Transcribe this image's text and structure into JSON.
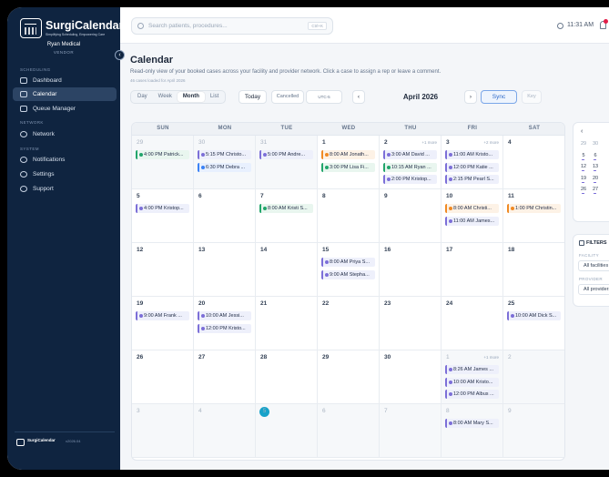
{
  "sidebar": {
    "brand": "SurgiCalendar",
    "tagline": "Simplifying Scheduling, Empowering Care",
    "user_name": "Ryan Medical",
    "user_role": "VENDOR",
    "sections": [
      {
        "label": "SCHEDULING"
      },
      {
        "label": "NETWORK"
      },
      {
        "label": "SYSTEM"
      }
    ],
    "items": [
      {
        "label": "Dashboard",
        "icon": "dashboard-icon"
      },
      {
        "label": "Calendar",
        "icon": "calendar-icon",
        "active": true
      },
      {
        "label": "Queue Manager",
        "icon": "queue-icon"
      },
      {
        "label": "Network",
        "icon": "network-icon"
      },
      {
        "label": "Notifications",
        "icon": "bell-icon"
      },
      {
        "label": "Settings",
        "icon": "gear-icon"
      },
      {
        "label": "Support",
        "icon": "help-icon"
      }
    ],
    "footer_brand": "SurgiCalendar",
    "footer_version": "v2026.04"
  },
  "topbar": {
    "search_placeholder": "Search patients, procedures...",
    "shortcut": "Ctrl+K",
    "time": "11:31 AM"
  },
  "page": {
    "title": "Calendar",
    "subtitle": "Read-only view of your booked cases across your facility and provider network. Click a case to assign a rep or leave a comment.",
    "loaded": "46 cases loaded for April 2026"
  },
  "toolbar": {
    "views": [
      "Day",
      "Week",
      "Month",
      "List"
    ],
    "selected_view": "Month",
    "today": "Today",
    "cancelled": "Cancelled",
    "timezone": "UTC-5",
    "prev": "‹",
    "month_label": "April 2026",
    "next": "›",
    "sync": "Sync",
    "key": "Key"
  },
  "calendar": {
    "weekdays": [
      "SUN",
      "MON",
      "TUE",
      "WED",
      "THU",
      "FRI",
      "SAT"
    ],
    "days": [
      {
        "n": "29",
        "out": true,
        "events": [
          {
            "t": "4:00 PM Patrick...",
            "c": "green"
          }
        ]
      },
      {
        "n": "30",
        "out": true,
        "events": [
          {
            "t": "5:15 PM Christo...",
            "c": "purple"
          },
          {
            "t": "6:30 PM Debra ...",
            "c": "blue"
          }
        ]
      },
      {
        "n": "31",
        "out": true,
        "events": [
          {
            "t": "5:00 PM Andre...",
            "c": "purple"
          }
        ]
      },
      {
        "n": "1",
        "events": [
          {
            "t": "8:00 AM Jonath...",
            "c": "orange"
          },
          {
            "t": "3:00 PM Lisa Fi...",
            "c": "green"
          }
        ]
      },
      {
        "n": "2",
        "more": "+1 more",
        "events": [
          {
            "t": "3:00 AM David ...",
            "c": "purple"
          },
          {
            "t": "10:15 AM Ryan ...",
            "c": "green"
          },
          {
            "t": "2:00 PM Kristop...",
            "c": "purple"
          }
        ]
      },
      {
        "n": "3",
        "more": "+2 more",
        "events": [
          {
            "t": "11:00 AM Kristo...",
            "c": "purple"
          },
          {
            "t": "12:00 PM Katie ...",
            "c": "purple"
          },
          {
            "t": "2:15 PM Pearl S...",
            "c": "purple"
          }
        ]
      },
      {
        "n": "4",
        "events": []
      },
      {
        "n": "5",
        "events": [
          {
            "t": "4:00 PM Kristop...",
            "c": "purple"
          }
        ]
      },
      {
        "n": "6",
        "events": []
      },
      {
        "n": "7",
        "events": [
          {
            "t": "8:00 AM Kristi S...",
            "c": "green"
          }
        ]
      },
      {
        "n": "8",
        "events": []
      },
      {
        "n": "9",
        "events": []
      },
      {
        "n": "10",
        "events": [
          {
            "t": "8:00 AM Christi...",
            "c": "orange"
          },
          {
            "t": "11:00 AM James...",
            "c": "purple"
          }
        ]
      },
      {
        "n": "11",
        "events": [
          {
            "t": "1:00 PM Christin...",
            "c": "orange"
          }
        ]
      },
      {
        "n": "12",
        "events": []
      },
      {
        "n": "13",
        "events": []
      },
      {
        "n": "14",
        "events": []
      },
      {
        "n": "15",
        "events": [
          {
            "t": "8:00 AM Priya S...",
            "c": "purple"
          },
          {
            "t": "9:00 AM Stepha...",
            "c": "purple"
          }
        ]
      },
      {
        "n": "16",
        "events": []
      },
      {
        "n": "17",
        "events": []
      },
      {
        "n": "18",
        "events": []
      },
      {
        "n": "19",
        "events": [
          {
            "t": "9:00 AM Frank ...",
            "c": "purple"
          }
        ]
      },
      {
        "n": "20",
        "events": [
          {
            "t": "10:00 AM Jessi...",
            "c": "purple"
          },
          {
            "t": "12:00 PM Kristo...",
            "c": "purple"
          }
        ]
      },
      {
        "n": "21",
        "events": []
      },
      {
        "n": "22",
        "events": []
      },
      {
        "n": "23",
        "events": []
      },
      {
        "n": "24",
        "events": []
      },
      {
        "n": "25",
        "events": [
          {
            "t": "10:00 AM Dick S...",
            "c": "purple"
          }
        ]
      },
      {
        "n": "26",
        "events": []
      },
      {
        "n": "27",
        "events": []
      },
      {
        "n": "28",
        "events": []
      },
      {
        "n": "29",
        "events": []
      },
      {
        "n": "30",
        "events": []
      },
      {
        "n": "1",
        "out": true,
        "more": "+1 more",
        "events": [
          {
            "t": "8:26 AM James ...",
            "c": "purple"
          },
          {
            "t": "10:00 AM Kristo...",
            "c": "purple"
          },
          {
            "t": "12:00 PM Albus ...",
            "c": "purple"
          }
        ]
      },
      {
        "n": "2",
        "out": true,
        "events": []
      },
      {
        "n": "3",
        "out": true,
        "events": []
      },
      {
        "n": "4",
        "out": true,
        "events": []
      },
      {
        "n": "5",
        "out": true,
        "today": true,
        "events": []
      },
      {
        "n": "6",
        "out": true,
        "events": []
      },
      {
        "n": "7",
        "out": true,
        "events": []
      },
      {
        "n": "8",
        "out": true,
        "events": [
          {
            "t": "8:00 AM Mary S...",
            "c": "purple"
          }
        ]
      },
      {
        "n": "9",
        "out": true,
        "events": []
      }
    ]
  },
  "mini_calendar": {
    "prev": "‹",
    "rows": [
      [
        "29",
        "30"
      ],
      [
        "5",
        "6"
      ],
      [
        "12",
        "13"
      ],
      [
        "19",
        "20"
      ],
      [
        "26",
        "27"
      ]
    ]
  },
  "filters": {
    "title": "FILTERS",
    "facility_label": "FACILITY",
    "facility_value": "All facilities",
    "provider_label": "PROVIDER",
    "provider_value": "All providers"
  },
  "colors": {
    "purple": "#7c6fd8",
    "green": "#22a56b",
    "orange": "#f08a24",
    "blue": "#3b82f6",
    "today": "#17a2c9",
    "sidebar": "#0f2440"
  }
}
